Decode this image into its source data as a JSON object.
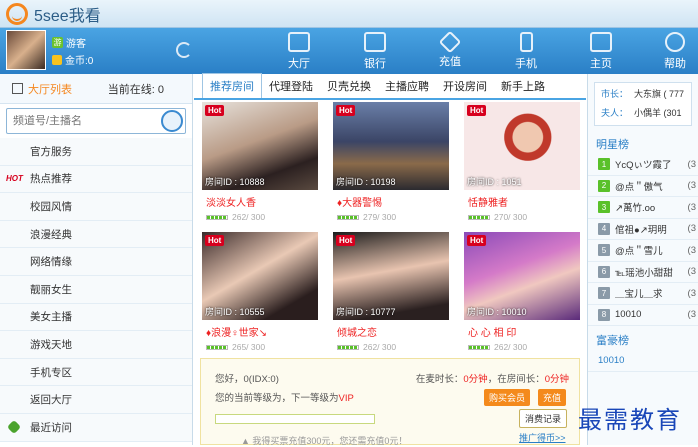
{
  "app": {
    "title": "5see我看"
  },
  "user": {
    "name": "游客",
    "name_badge": "游",
    "coins": "金币:0",
    "coin_badge": "币"
  },
  "nav": [
    {
      "label": "大厅",
      "icon": "hall-icon"
    },
    {
      "label": "银行",
      "icon": "bank-icon"
    },
    {
      "label": "充值",
      "icon": "diamond-icon"
    },
    {
      "label": "手机",
      "icon": "phone-icon"
    },
    {
      "label": "主页",
      "icon": "home-icon"
    },
    {
      "label": "帮助",
      "icon": "help-icon"
    }
  ],
  "left": {
    "header": "大厅列表",
    "online": "当前在线: 0",
    "search_placeholder": "频道号/主播名",
    "hot_tag": "HOT",
    "items": [
      "官方服务",
      "热点推荐",
      "校园风情",
      "浪漫经典",
      "网络情缘",
      "靓丽女生",
      "美女主播",
      "游戏天地",
      "手机专区",
      "返回大厅",
      "最近访问"
    ]
  },
  "tabs": [
    "推荐房间",
    "代理登陆",
    "贝壳兑换",
    "主播应聘",
    "开设房间",
    "新手上路"
  ],
  "rooms": [
    {
      "hot": "Hot",
      "room_id": "房间ID : 10888",
      "name": "淡淡女人香",
      "count": "262/ 300"
    },
    {
      "hot": "Hot",
      "room_id": "房间ID : 10198",
      "name": "♦大器警惕",
      "count": "279/ 300"
    },
    {
      "hot": "Hot",
      "room_id": "房间ID : 1051",
      "name": "恬静雅者",
      "count": "270/ 300"
    },
    {
      "hot": "Hot",
      "room_id": "房间ID : 10555",
      "name": "♦浪漫♀世家↘",
      "count": "265/ 300"
    },
    {
      "hot": "Hot",
      "room_id": "房间ID : 10777",
      "name": "倾城之恋",
      "count": "262/ 300"
    },
    {
      "hot": "Hot",
      "room_id": "房间ID : 10010",
      "name": "心 心 相 印",
      "count": "262/ 300"
    }
  ],
  "bottom": {
    "greeting": "您好，0(IDX:0)",
    "online_time_label": "在麦时长：",
    "online_time_val": "0分钟",
    "room_time_label": "，在房间长：",
    "room_time_val": "0分钟",
    "level_text": "您的当前等级为，下一等级为",
    "level_next": "VIP",
    "btn_vip": "购买会员",
    "btn_charge": "充值",
    "btn_consume": "消费记录",
    "promo": "推广得币>>",
    "promo_text": "▲ 我得买票充值300元，您还需充值0元！"
  },
  "right": {
    "chief_label": "市长：",
    "chief_val": "大东旗 ( 777",
    "lady_label": "夫人：",
    "lady_val": "小偶羊 (301",
    "star_title": "明星榜",
    "star_list": [
      {
        "n": "1",
        "name": "YcQぃツ霞了",
        "v": "(3"
      },
      {
        "n": "2",
        "name": "@点＂傲气",
        "v": "(3"
      },
      {
        "n": "3",
        "name": "↗萬竹.oo",
        "v": "(3"
      },
      {
        "n": "4",
        "name": "倌祖●↗玥明",
        "v": "(3"
      },
      {
        "n": "5",
        "name": "@点＂雪儿",
        "v": "(3"
      },
      {
        "n": "6",
        "name": "℡瑶池小甜甜",
        "v": "(3"
      },
      {
        "n": "7",
        "name": "＿宝儿＿求",
        "v": "(3"
      },
      {
        "n": "8",
        "name": "10010",
        "v": "(3"
      }
    ],
    "rich_title": "富豪榜",
    "rich_first": "10010"
  },
  "watermark": "最需教育"
}
